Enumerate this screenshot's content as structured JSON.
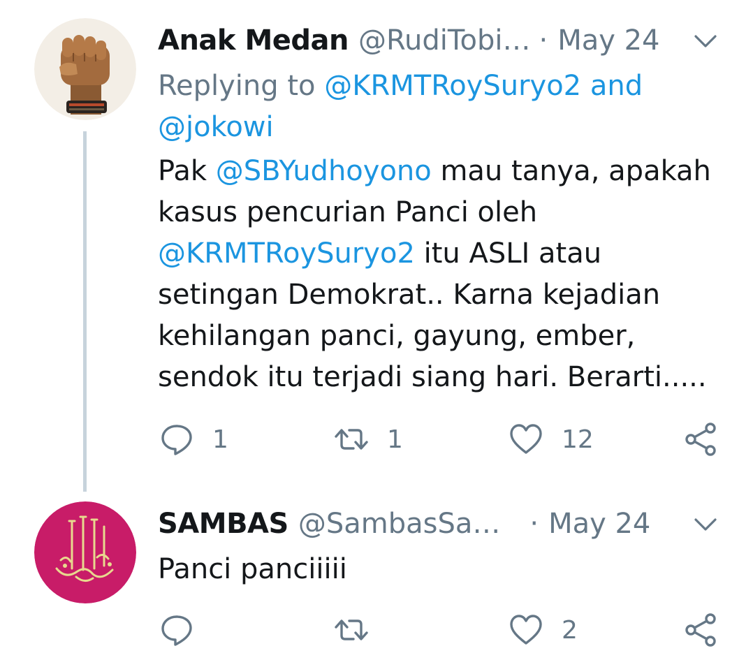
{
  "tweets": [
    {
      "name": "Anak Medan",
      "handle": "@RudiTobi…",
      "dot": "·",
      "date": "May 24",
      "replying_prefix": "Replying to",
      "replying_user1": "@KRMTRoySuryo2",
      "replying_and": "and",
      "replying_user2": "@jokowi",
      "body": {
        "p1": "Pak ",
        "m1": "@SBYudhoyono",
        "p2": " mau tanya, apakah kasus pencurian Panci oleh ",
        "m2": "@KRMTRoySuryo2",
        "p3": " itu ASLI atau setingan Demokrat.. Karna kejadian kehilangan panci, gayung, ember, sendok itu terjadi siang hari. Berarti....."
      },
      "replies": "1",
      "retweets": "1",
      "likes": "12",
      "avatar_icon": "raised-fist-avatar",
      "colors": {
        "link": "#1b95e0",
        "muted": "#657786",
        "thread_line": "#c7d3dc"
      }
    },
    {
      "name": "SAMBAS",
      "handle": "@SambasSa…",
      "dot": "·",
      "date": "May 24",
      "body_text": "Panci panciiiii",
      "likes": "2",
      "avatar_icon": "calligraphy-avatar",
      "colors": {
        "avatar_bg": "#d01f6c",
        "calligraphy": "#e8d98e"
      }
    }
  ]
}
